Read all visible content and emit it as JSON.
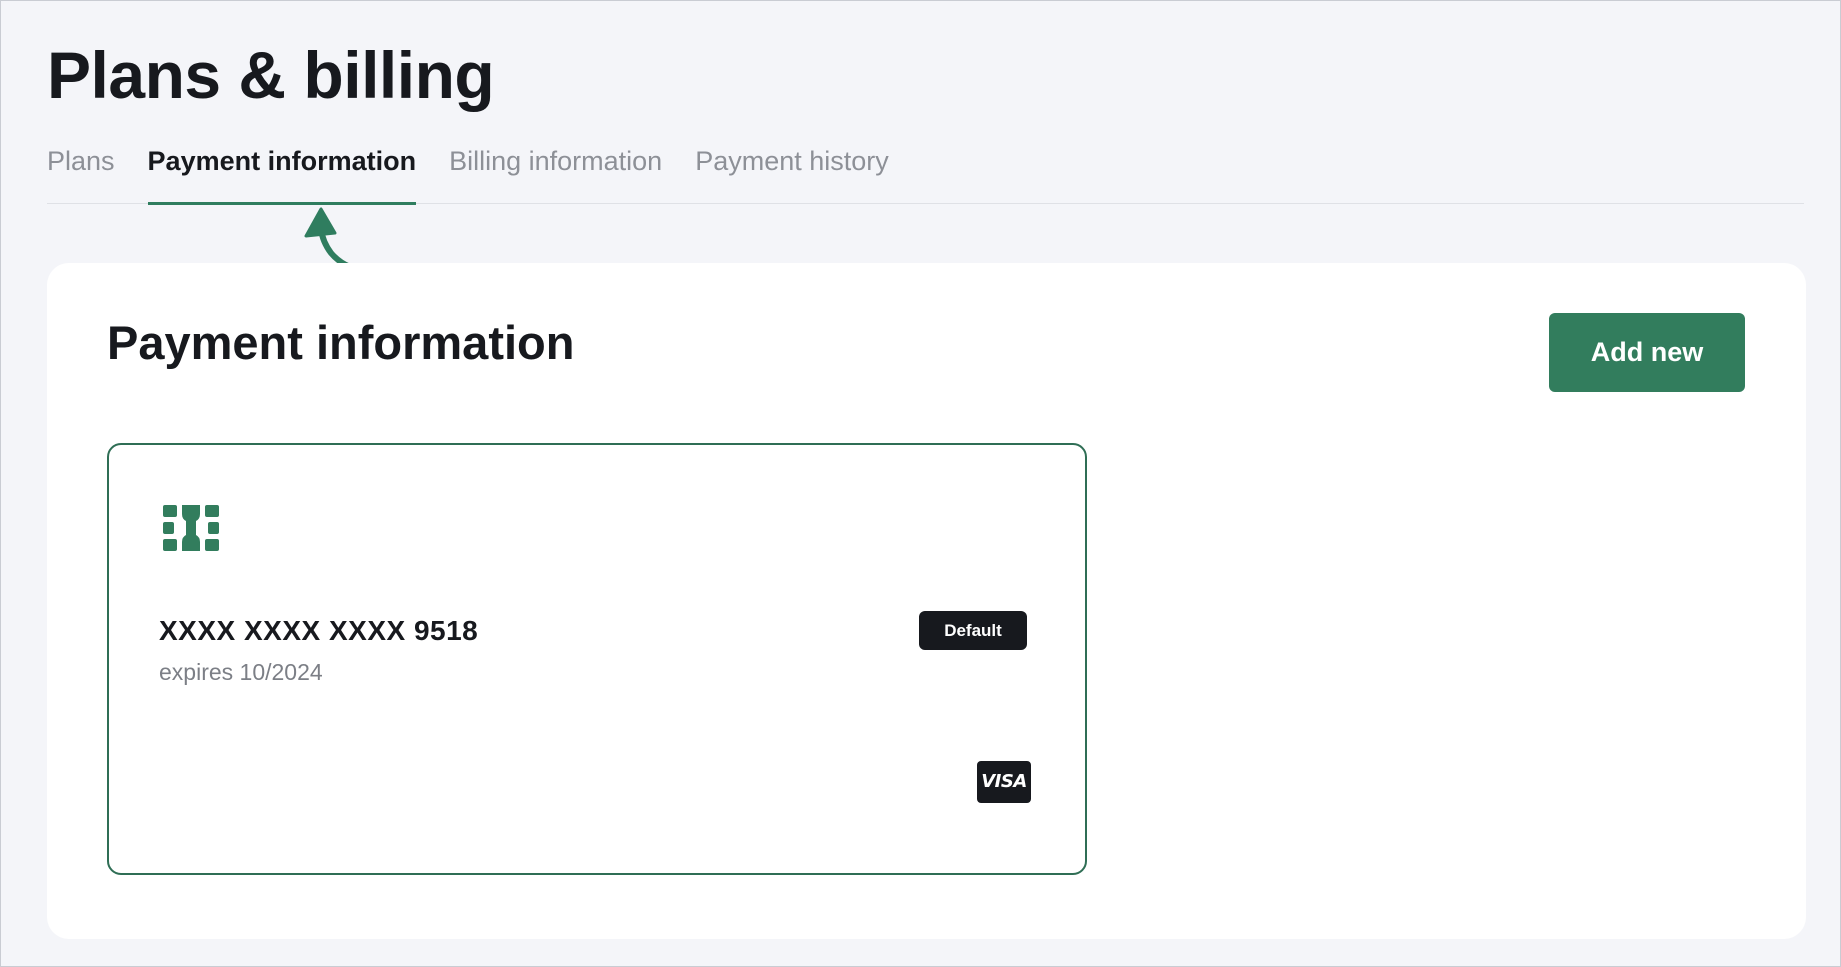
{
  "header": {
    "title": "Plans & billing"
  },
  "tabs": [
    {
      "label": "Plans",
      "active": false
    },
    {
      "label": "Payment information",
      "active": true
    },
    {
      "label": "Billing information",
      "active": false
    },
    {
      "label": "Payment history",
      "active": false
    }
  ],
  "annotation": {
    "icon": "curved-arrow-icon",
    "color": "#2f7d5f"
  },
  "panel": {
    "title": "Payment information",
    "add_button_label": "Add new"
  },
  "card": {
    "chip_icon": "card-chip-icon",
    "number": "XXXX XXXX XXXX 9518",
    "expiry": "expires 10/2024",
    "badge": "Default",
    "brand": "VISA",
    "border_color": "#2f6e55"
  },
  "colors": {
    "accent": "#327d5d",
    "text": "#17191e",
    "muted": "#8d9097",
    "background": "#f4f5f9"
  }
}
